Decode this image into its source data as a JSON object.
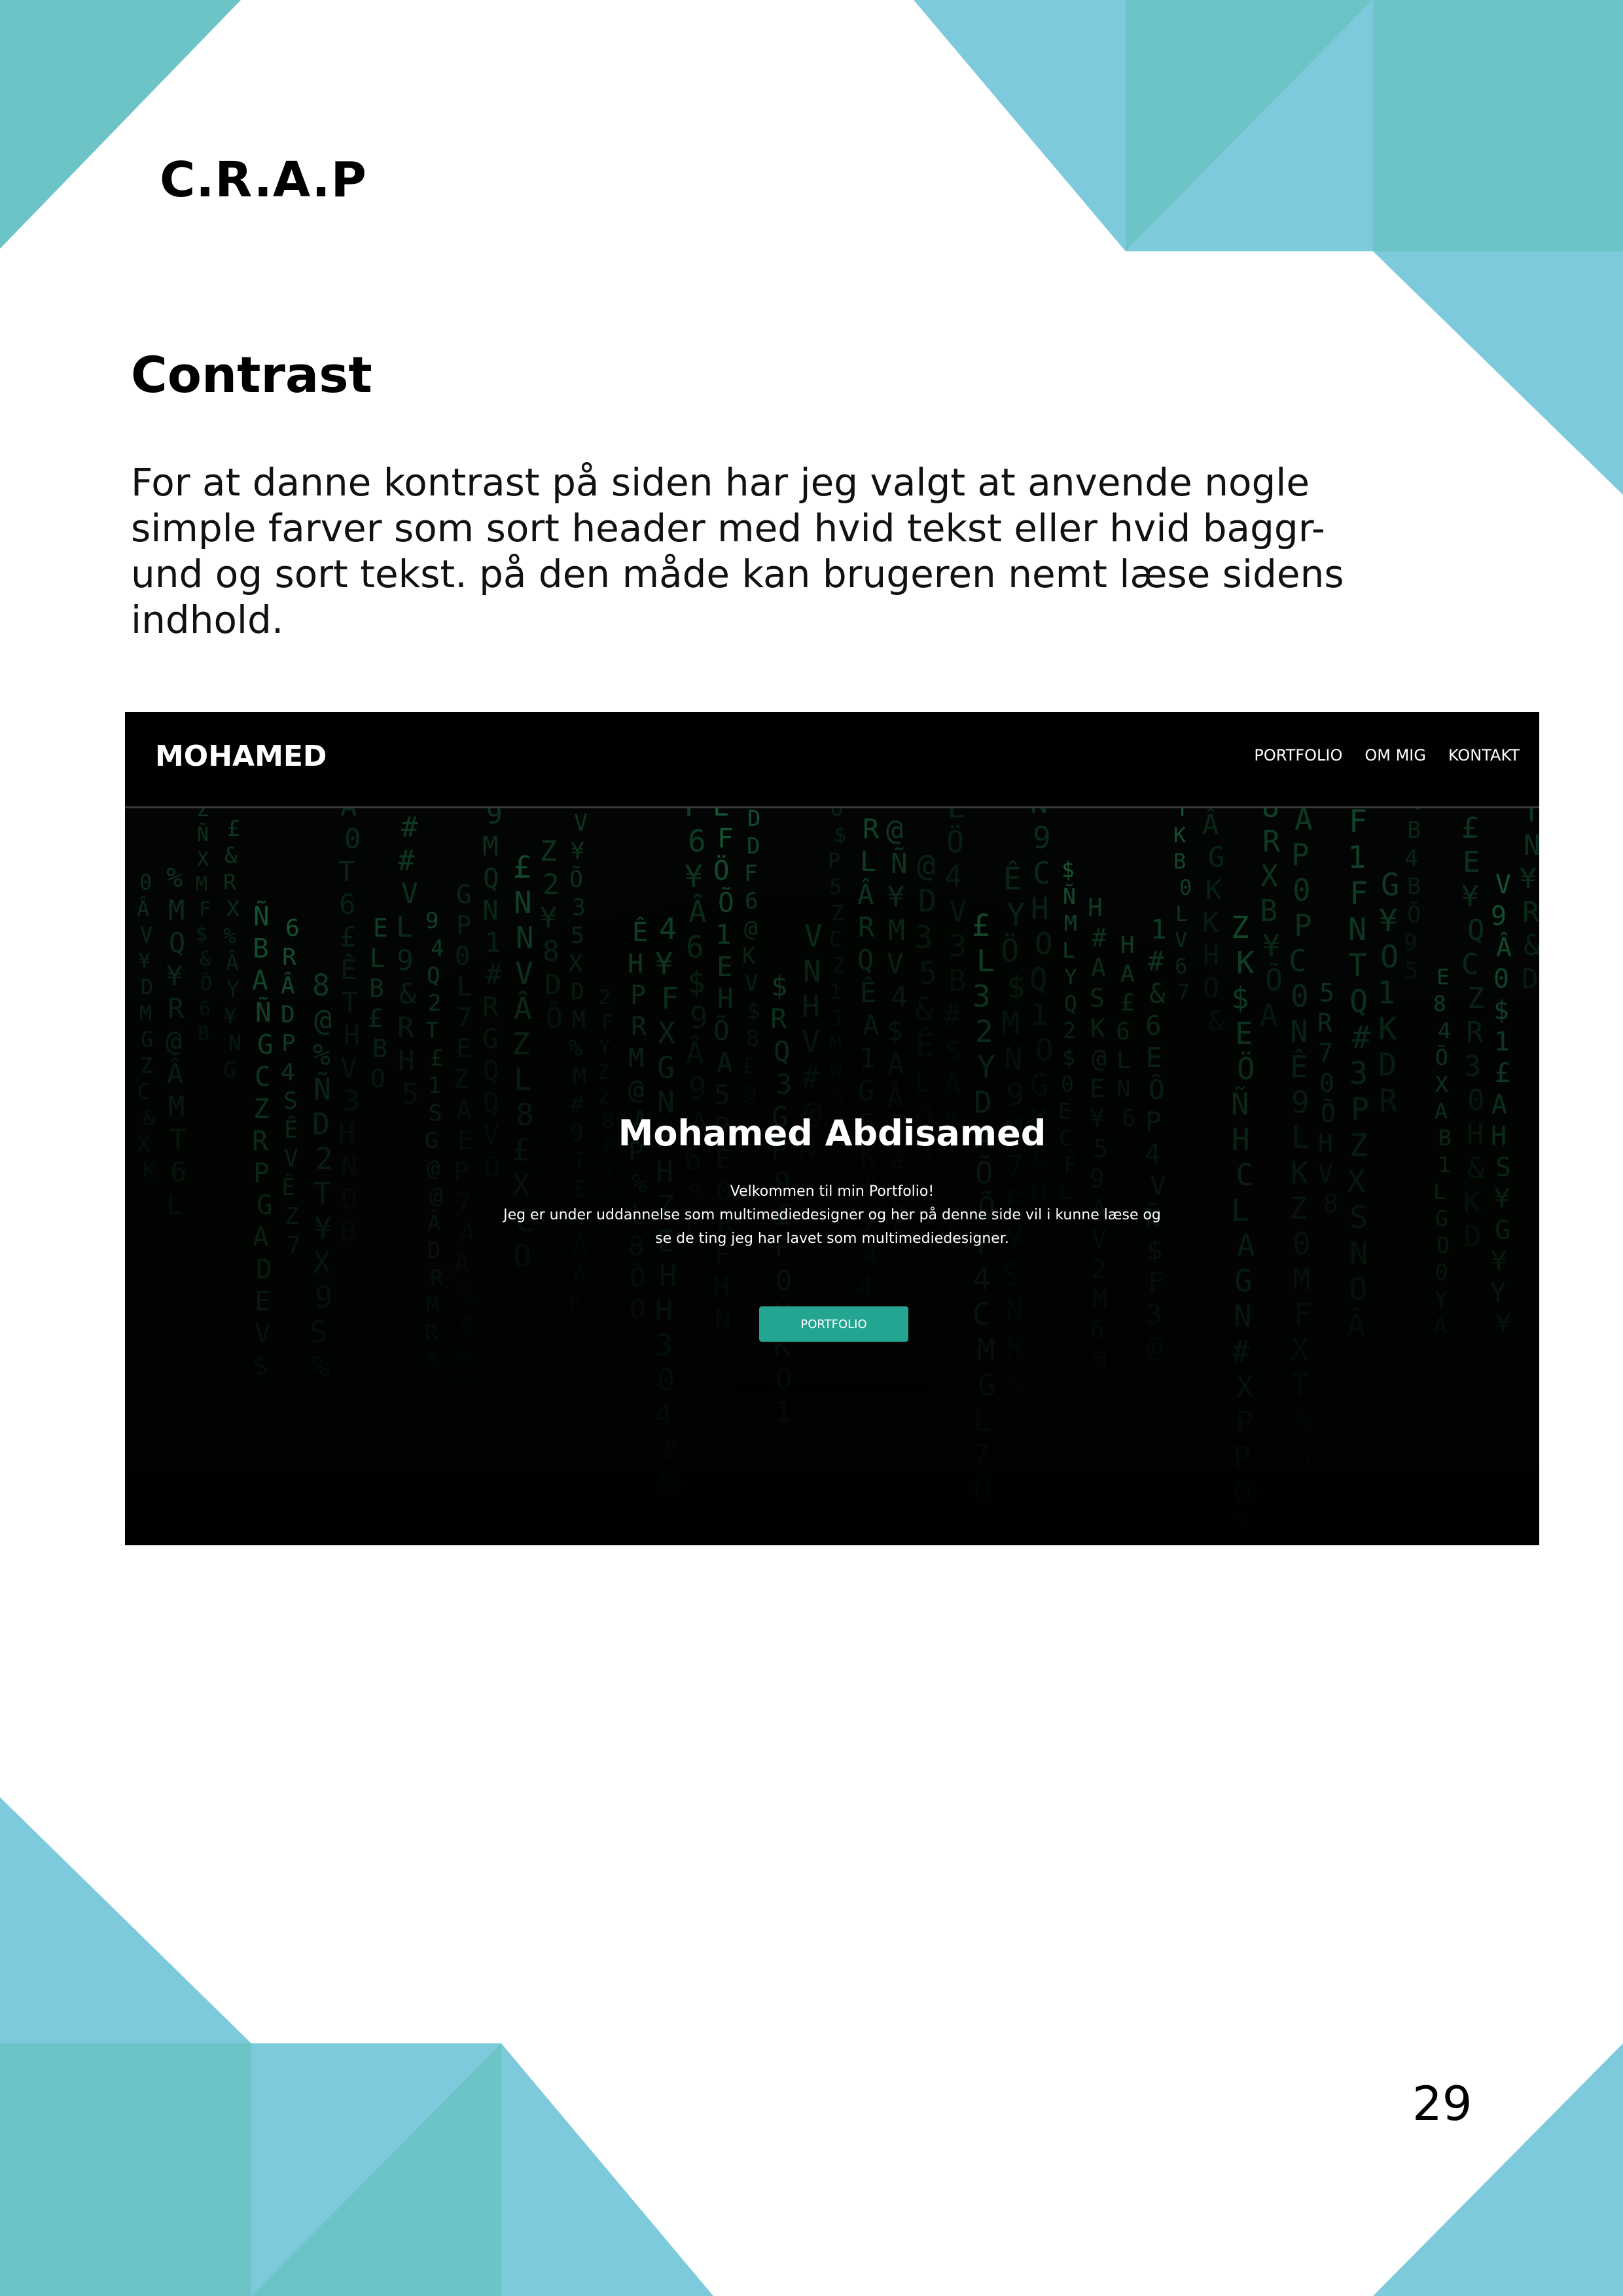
{
  "document": {
    "section_label": "C.R.A.P",
    "heading": "Contrast",
    "body_lines": [
      "For at danne kontrast på siden har jeg valgt at anvende nogle",
      "simple farver som sort header med hvid tekst eller hvid baggr-",
      "und og sort tekst. på den måde kan brugeren nemt læse sidens",
      "indhold."
    ],
    "page_number": "29"
  },
  "website": {
    "logo": "MOHAMED",
    "nav": [
      "PORTFOLIO",
      "OM MIG",
      "KONTAKT"
    ],
    "hero_title": "Mohamed Abdisamed",
    "hero_lines": [
      "Velkommen til min Portfolio!",
      "Jeg er under uddannelse som multimediedesigner og her på denne side vil i kunne læse og",
      "se de ting jeg har lavet som multimediedesigner."
    ],
    "hero_button": "PORTFOLIO"
  },
  "colors": {
    "teal_light": "#7ccadb",
    "teal_dark": "#6dc4c6",
    "button": "#23a591",
    "matrix_green": "#1f7a4a"
  }
}
